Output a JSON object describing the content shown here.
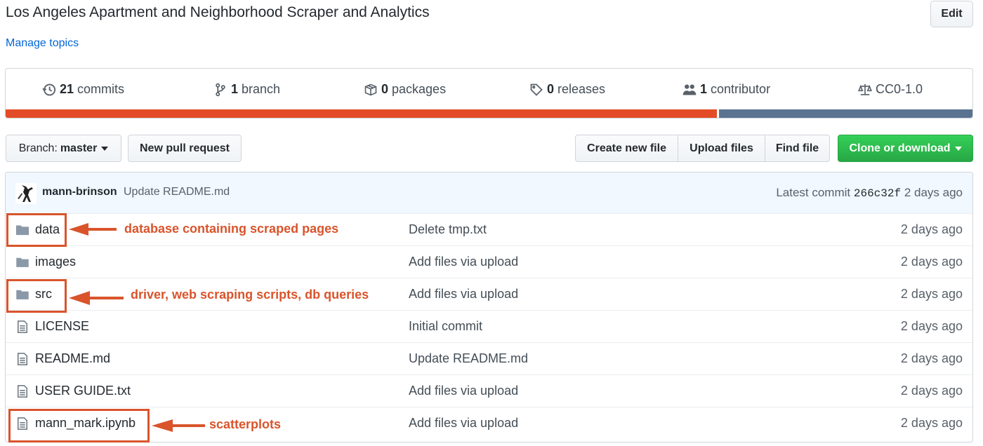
{
  "repo": {
    "description": "Los Angeles Apartment and Neighborhood Scraper and Analytics",
    "manage_topics": "Manage topics",
    "edit_label": "Edit"
  },
  "summary": {
    "commits": {
      "count": "21",
      "label": "commits",
      "icon": "history-icon"
    },
    "branches": {
      "count": "1",
      "label": "branch",
      "icon": "git-branch-icon"
    },
    "packages": {
      "count": "0",
      "label": "packages",
      "icon": "package-icon"
    },
    "releases": {
      "count": "0",
      "label": "releases",
      "icon": "tag-icon"
    },
    "contributors": {
      "count": "1",
      "label": "contributor",
      "icon": "people-icon"
    },
    "license": {
      "label": "CC0-1.0",
      "icon": "law-icon"
    },
    "language_bar": [
      {
        "color": "#e34c26",
        "fraction": 0.736
      },
      {
        "color": "#ffffff",
        "fraction": 0.002
      },
      {
        "color": "#5a7390",
        "fraction": 0.262
      }
    ]
  },
  "toolbar": {
    "branch_prefix": "Branch:",
    "branch_name": "master",
    "new_pull_request": "New pull request",
    "create_new_file": "Create new file",
    "upload_files": "Upload files",
    "find_file": "Find file",
    "clone_or_download": "Clone or download",
    "clone_color": "#28a745"
  },
  "latest_commit": {
    "author": "mann-brinson",
    "message": "Update README.md",
    "prefix": "Latest commit",
    "sha": "266c32f",
    "age": "2 days ago"
  },
  "files": [
    {
      "name": "data",
      "type": "folder",
      "icon": "folder-icon",
      "message": "Delete tmp.txt",
      "age": "2 days ago"
    },
    {
      "name": "images",
      "type": "folder",
      "icon": "folder-icon",
      "message": "Add files via upload",
      "age": "2 days ago"
    },
    {
      "name": "src",
      "type": "folder",
      "icon": "folder-icon",
      "message": "Add files via upload",
      "age": "2 days ago"
    },
    {
      "name": "LICENSE",
      "type": "file",
      "icon": "file-icon",
      "message": "Initial commit",
      "age": "2 days ago"
    },
    {
      "name": "README.md",
      "type": "file",
      "icon": "file-icon",
      "message": "Update README.md",
      "age": "2 days ago"
    },
    {
      "name": "USER GUIDE.txt",
      "type": "file",
      "icon": "file-icon",
      "message": "Add files via upload",
      "age": "2 days ago"
    },
    {
      "name": "mann_mark.ipynb",
      "type": "file",
      "icon": "file-icon",
      "message": "Add files via upload",
      "age": "2 days ago"
    }
  ],
  "annotations": {
    "data": "database containing scraped pages",
    "src": "driver, web scraping scripts, db queries",
    "notebook": "scatterplots",
    "color": "#d9542b"
  }
}
